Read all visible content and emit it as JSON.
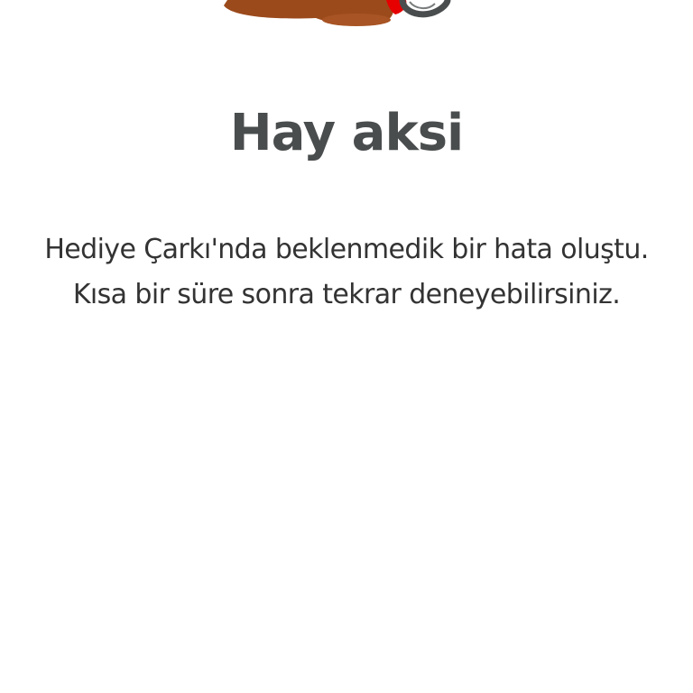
{
  "error_screen": {
    "illustration_icon": "spilled-drink-icon",
    "title": "Hay aksi",
    "message_line_1": "Hediye Çarkı'nda beklenmedik bir hata oluştu.",
    "message_line_2": "Kısa bir süre sonra tekrar deneyebilirsiniz."
  },
  "colors": {
    "title": "#4a4d4e",
    "message": "#333333",
    "background": "#ffffff",
    "accent_red": "#e60000",
    "brown": "#9b4a1c"
  }
}
